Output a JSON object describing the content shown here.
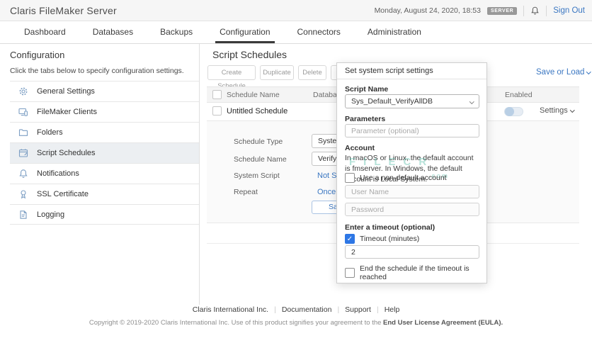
{
  "topbar": {
    "logo": "Claris FileMaker Server",
    "datetime": "Monday, August 24, 2020, 18:53",
    "badge": "SERVER",
    "sign_out": "Sign Out"
  },
  "nav": {
    "tabs": [
      {
        "label": "Dashboard",
        "active": false
      },
      {
        "label": "Databases",
        "active": false
      },
      {
        "label": "Backups",
        "active": false
      },
      {
        "label": "Configuration",
        "active": true
      },
      {
        "label": "Connectors",
        "active": false
      },
      {
        "label": "Administration",
        "active": false
      }
    ]
  },
  "sidebar": {
    "title": "Configuration",
    "subtitle": "Click the tabs below to specify configuration settings.",
    "items": [
      {
        "label": "General Settings",
        "icon": "gear-icon",
        "selected": false
      },
      {
        "label": "FileMaker Clients",
        "icon": "clients-icon",
        "selected": false
      },
      {
        "label": "Folders",
        "icon": "folder-icon",
        "selected": false
      },
      {
        "label": "Script Schedules",
        "icon": "calendar-icon",
        "selected": true
      },
      {
        "label": "Notifications",
        "icon": "bell-icon",
        "selected": false
      },
      {
        "label": "SSL Certificate",
        "icon": "certificate-icon",
        "selected": false
      },
      {
        "label": "Logging",
        "icon": "log-icon",
        "selected": false
      }
    ]
  },
  "main": {
    "title": "Script Schedules",
    "toolbar": {
      "create": "Create Schedule",
      "duplicate": "Duplicate",
      "delete": "Delete"
    },
    "save_or_load": "Save or Load",
    "table": {
      "columns": {
        "name": "Schedule Name",
        "database": "Database",
        "enabled": "Enabled"
      },
      "row": {
        "name": "Untitled Schedule",
        "enabled": false,
        "settings_label": "Settings"
      }
    },
    "form": {
      "fields": [
        {
          "label": "Schedule Type",
          "control": "select",
          "value": "System S"
        },
        {
          "label": "Schedule Name",
          "control": "select",
          "value": "Verify Al"
        },
        {
          "label": "System Script",
          "control": "link",
          "value": "Not Set"
        },
        {
          "label": "Repeat",
          "control": "link",
          "value": "Once"
        }
      ],
      "save_label": "Save"
    }
  },
  "modal": {
    "title": "Set system script settings",
    "script_name_label": "Script Name",
    "script_name_value": "Sys_Default_VerifyAllDB",
    "parameters_label": "Parameters",
    "parameters_placeholder": "Parameter (optional)",
    "account_label": "Account",
    "account_text": "In macOS or Linux, the default account is fmserver. In Windows, the default account is Local System.",
    "non_default_checkbox_label": "Use a non-default account",
    "non_default_checked": false,
    "username_placeholder": "User Name",
    "password_placeholder": "Password",
    "timeout_section_label": "Enter a timeout (optional)",
    "timeout_checkbox_label": "Timeout (minutes)",
    "timeout_checked": true,
    "timeout_value": "2",
    "check_glyph": "✓",
    "end_schedule_checkbox_label": "End the schedule if the timeout is reached",
    "end_schedule_checked": false
  },
  "watermark": {
    "line1": "FILECR",
    "line2": ".com"
  },
  "footer": {
    "links": [
      "Claris International Inc.",
      "Documentation",
      "Support",
      "Help"
    ],
    "copyright_prefix": "Copyright © 2019-2020 Claris International Inc. Use of this product signifies your agreement to the ",
    "copyright_strong": "End User License Agreement (EULA)."
  },
  "colors": {
    "accent_blue": "#3b77c2",
    "checkbox_checked_blue": "#2e77e5",
    "badge_gray": "#999999",
    "sidebar_icon_blue": "#7d9fc4",
    "selected_item_bg": "#eceff2",
    "topbar_bg": "#f6f6f6",
    "watermark_teal": "#3eb29c"
  }
}
